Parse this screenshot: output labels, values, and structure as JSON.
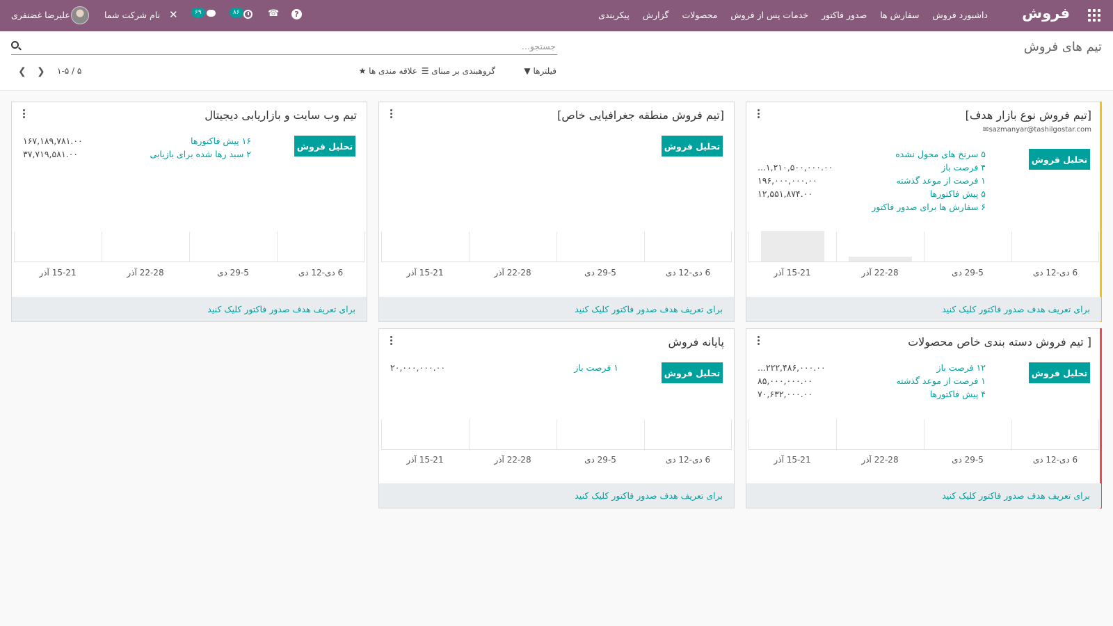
{
  "topbar": {
    "app_title": "فروش",
    "menu": [
      "داشبورد فروش",
      "سفارش ها",
      "صدور فاکتور",
      "خدمات پس از فروش",
      "محصولات",
      "گزارش",
      "پیکربندی"
    ],
    "activities_count": "۸۶",
    "messages_count": "۶۹",
    "company_name": "نام شرکت شما",
    "user_name": "علیرضا غضنفری"
  },
  "control": {
    "breadcrumb": "تیم های فروش",
    "search_placeholder": "جستجو...",
    "filters_label": "فیلترها",
    "groupby_label": "گروهبندی بر مبنای",
    "favorites_label": "علاقه مندی ها",
    "pager_value": "۱-۵ / ۵"
  },
  "common": {
    "analysis_button": "تحلیل فروش",
    "footer_text": "برای تعریف هدف صدور فاکتور کلیک کنید",
    "ticks": [
      "6 دی-12 دی",
      "29-5 دی",
      "22-28 آذر",
      "15-21 آذر"
    ]
  },
  "colors": {
    "brand": "#875a7b",
    "accent": "#00a09d",
    "yellow_tag": "#f0c419",
    "red_tag": "#e05050"
  },
  "cards": [
    {
      "title": "[تیم فروش نوع بازار هدف]",
      "email": "sazmanyar@tashilgostar.com",
      "stats": [
        {
          "label": "۵ سرنخ های محول نشده",
          "value": ""
        },
        {
          "label": "۴ فرصت باز",
          "value": "...۱,۲۱۰,۵۰۰,۰۰۰.۰۰"
        },
        {
          "label": "۱ فرصت از موعد گذشته",
          "value": "۱۹۶,۰۰۰,۰۰۰.۰۰"
        },
        {
          "label": "۵ پیش فاکتورها",
          "value": "۱۲,۵۵۱,۸۷۴.۰۰"
        },
        {
          "label": "۶ سفارش ها برای صدور فاکتور",
          "value": ""
        }
      ]
    },
    {
      "title": "[تیم فروش منطقه جغرافیایی خاص]",
      "stats": []
    },
    {
      "title": "تیم وب سایت و بازاریابی دیجیتال",
      "stats": [
        {
          "label": "۱۶ پیش فاکتورها",
          "value": "۱۶۷,۱۸۹,۷۸۱.۰۰"
        },
        {
          "label": "۲ سبد رها شده برای بازیابی",
          "value": "۳۷,۷۱۹,۵۸۱.۰۰"
        }
      ]
    },
    {
      "title": "[ تیم فروش دسته بندی خاص محصولات",
      "stats": [
        {
          "label": "۱۲ فرصت باز",
          "value": "...۲۲۲,۴۸۶,۰۰۰.۰۰"
        },
        {
          "label": "۱ فرصت از موعد گذشته",
          "value": "۸۵,۰۰۰,۰۰۰.۰۰"
        },
        {
          "label": "۴ پیش فاکتورها",
          "value": "۷۰,۶۳۲,۰۰۰.۰۰"
        }
      ]
    },
    {
      "title": "پایانه فروش",
      "stats": [
        {
          "label": "۱ فرصت باز",
          "value": "۲۰,۰۰۰,۰۰۰.۰۰"
        }
      ]
    }
  ]
}
